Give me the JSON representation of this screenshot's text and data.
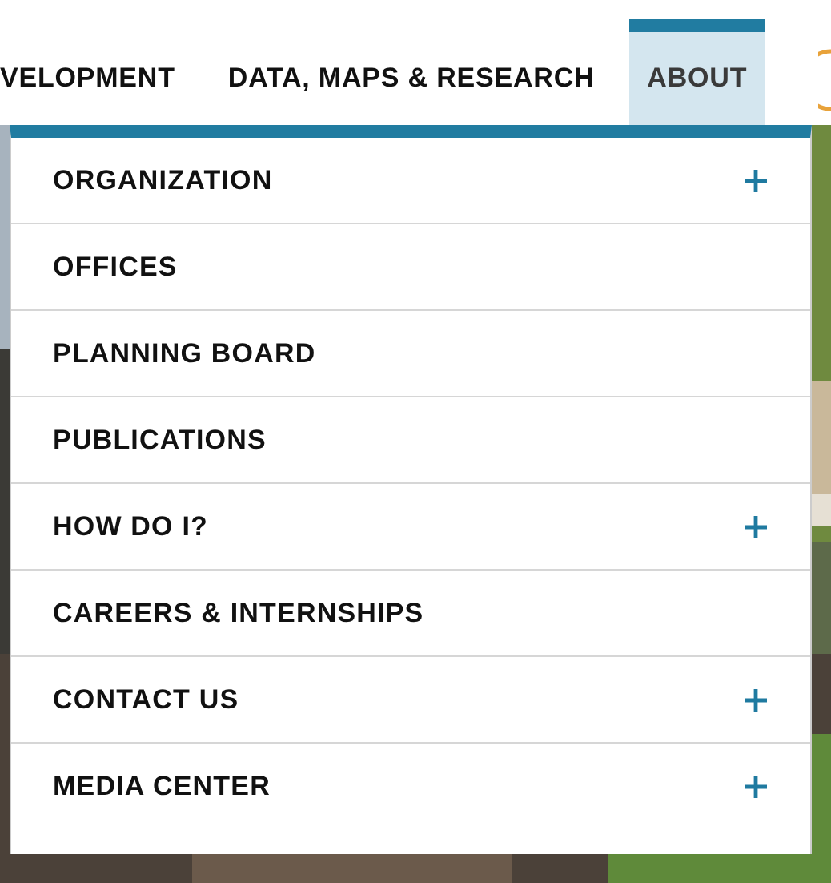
{
  "nav": [
    {
      "label": "VELOPMENT",
      "selected": false
    },
    {
      "label": "DATA, MAPS & RESEARCH",
      "selected": false
    },
    {
      "label": "ABOUT",
      "selected": true
    }
  ],
  "menu": [
    {
      "label": "ORGANIZATION",
      "expandable": true
    },
    {
      "label": "OFFICES",
      "expandable": false
    },
    {
      "label": "PLANNING BOARD",
      "expandable": false
    },
    {
      "label": "PUBLICATIONS",
      "expandable": false
    },
    {
      "label": "HOW DO I?",
      "expandable": true
    },
    {
      "label": "CAREERS & INTERNSHIPS",
      "expandable": false
    },
    {
      "label": "CONTACT US",
      "expandable": true
    },
    {
      "label": "MEDIA CENTER",
      "expandable": true
    }
  ]
}
